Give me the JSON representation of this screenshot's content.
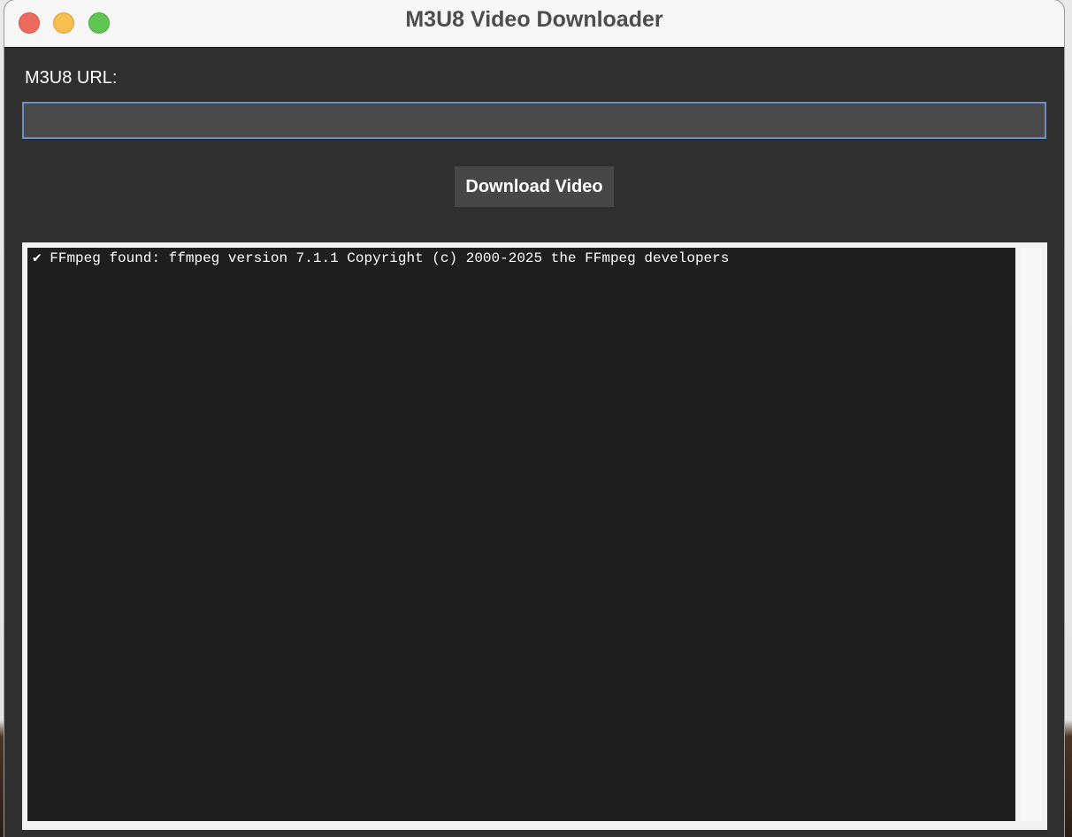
{
  "window": {
    "title": "M3U8 Video Downloader"
  },
  "form": {
    "url_label": "M3U8 URL:",
    "url_value": "",
    "url_placeholder": "",
    "download_label": "Download Video"
  },
  "log": {
    "lines": [
      "✔ FFmpeg found: ffmpeg version 7.1.1 Copyright (c) 2000-2025 the FFmpeg developers"
    ]
  },
  "colors": {
    "close": "#ec6a5e",
    "minimize": "#f4bf4f",
    "maximize": "#61c554",
    "input_focus": "#6b8fc7"
  }
}
